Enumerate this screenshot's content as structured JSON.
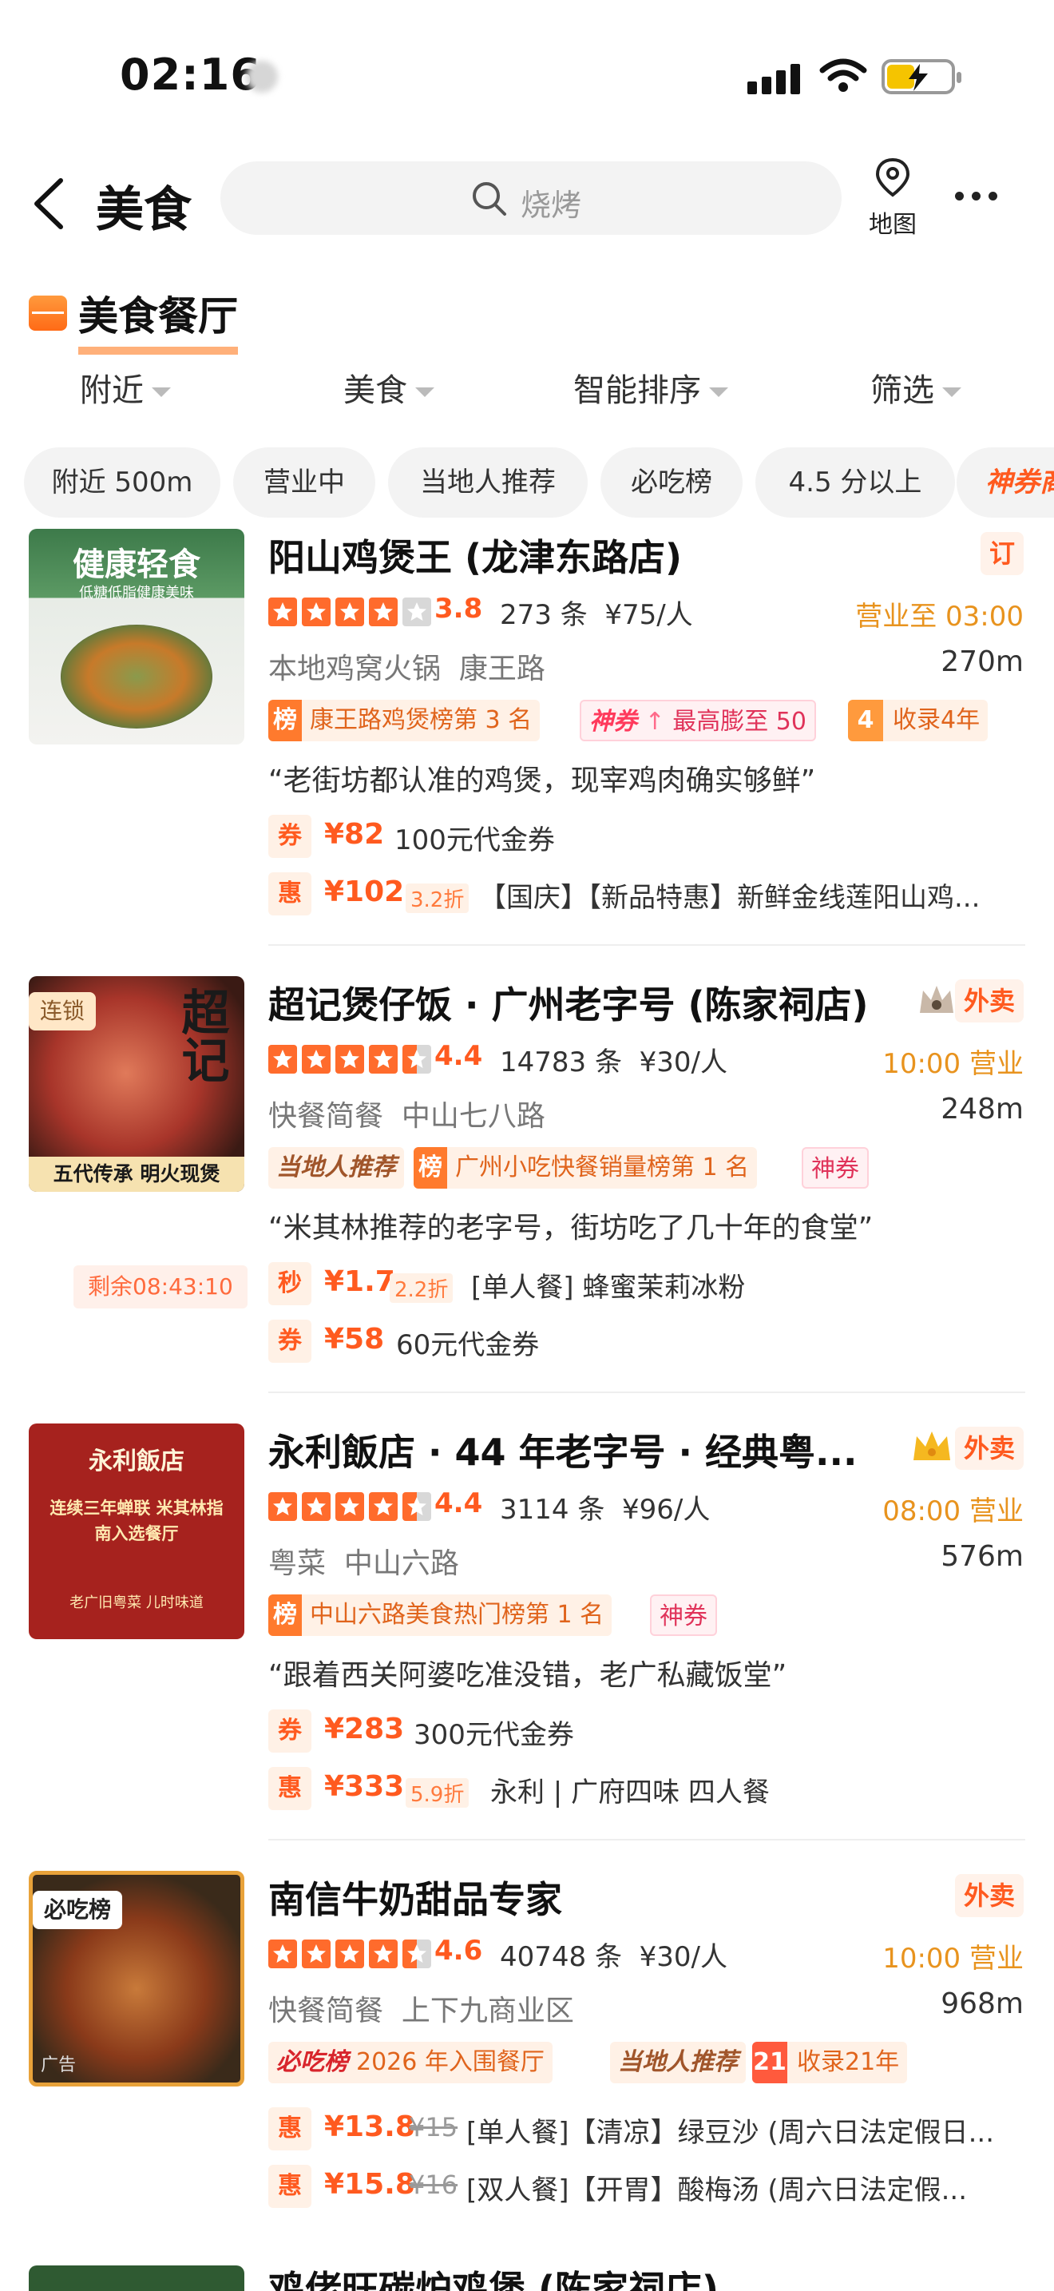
{
  "status_bar": {
    "time": "02:16"
  },
  "nav": {
    "title": "美食",
    "search_placeholder": "烧烤",
    "map_label": "地图"
  },
  "category": {
    "title": "美食餐厅"
  },
  "dropdowns": [
    "附近",
    "美食",
    "智能排序",
    "筛选"
  ],
  "chips": [
    "附近 500m",
    "营业中",
    "当地人推荐",
    "必吃榜",
    "4.5 分以上",
    "神券商"
  ],
  "colors": {
    "accent": "#ff5a1f",
    "star": "#ff6b2c",
    "status": "#e8931e"
  },
  "restaurants": [
    {
      "name": "阳山鸡煲王 (龙津东路店)",
      "badge": "订",
      "thumb_title": "健康轻食",
      "thumb_sub": "低糖低脂健康美味",
      "rating": 3.8,
      "rating_text": "3.8",
      "reviews": "273 条",
      "price": "¥75/人",
      "status": "营业至 03:00",
      "cuisine": "本地鸡窝火锅",
      "area": "康王路",
      "distance": "270m",
      "tag_bang_prefix": "榜",
      "tag_bang": "康王路鸡煲榜第 3 名",
      "tag_shen_prefix": "神券",
      "tag_shen": "最高膨至 50",
      "tag_year_num": "4",
      "tag_year": "收录4年",
      "quote": "“老街坊都认准的鸡煲，现宰鸡肉确实够鲜”",
      "deals": [
        {
          "kind": "券",
          "price": "¥82",
          "desc": "100元代金券"
        },
        {
          "kind": "惠",
          "price": "¥102",
          "discount": "3.2折",
          "desc": "【国庆】【新品特惠】新鲜金线莲阳山鸡..."
        }
      ]
    },
    {
      "name": "超记煲仔饭 · 广州老字号 (陈家祠店)",
      "badge": "外卖",
      "corner_tag": "连锁",
      "thumb_title": "超记",
      "thumb_sub": "五代传承 明火现煲",
      "rating": 4.4,
      "rating_text": "4.4",
      "reviews": "14783 条",
      "price": "¥30/人",
      "status": "10:00 营业",
      "cuisine": "快餐简餐",
      "area": "中山七八路",
      "distance": "248m",
      "tag_local": "当地人推荐",
      "tag_bang_prefix": "榜",
      "tag_bang": "广州小吃快餐销量榜第 1 名",
      "tag_shen_only": "神券",
      "quote": "“米其林推荐的老字号，街坊吃了几十年的食堂”",
      "countdown": "剩余08:43:10",
      "deals": [
        {
          "kind": "秒",
          "price": "¥1.7",
          "discount": "2.2折",
          "desc": "[单人餐] 蜂蜜茉莉冰粉"
        },
        {
          "kind": "券",
          "price": "¥58",
          "desc": "60元代金券"
        }
      ]
    },
    {
      "name": "永利飯店 · 44 年老字号 · 经典粤...",
      "badge": "外卖",
      "thumb_title": "永利飯店",
      "thumb_sub": "连续三年蝉联 米其林指南入选餐厅",
      "thumb_foot": "老广旧粤菜 儿时味道",
      "rating": 4.4,
      "rating_text": "4.4",
      "reviews": "3114 条",
      "price": "¥96/人",
      "status": "08:00 营业",
      "cuisine": "粤菜",
      "area": "中山六路",
      "distance": "576m",
      "tag_bang_prefix": "榜",
      "tag_bang": "中山六路美食热门榜第 1 名",
      "tag_shen_only": "神券",
      "quote": "“跟着西关阿婆吃准没错，老广私藏饭堂”",
      "deals": [
        {
          "kind": "券",
          "price": "¥283",
          "desc": "300元代金券"
        },
        {
          "kind": "惠",
          "price": "¥333",
          "discount": "5.9折",
          "desc": "永利 | 广府四味 四人餐"
        }
      ]
    },
    {
      "name": "南信牛奶甜品专家",
      "badge": "外卖",
      "corner_tag": "必吃榜",
      "ad_label": "广告",
      "rating": 4.6,
      "rating_text": "4.6",
      "reviews": "40748 条",
      "price": "¥30/人",
      "status": "10:00 营业",
      "cuisine": "快餐简餐",
      "area": "上下九商业区",
      "distance": "968m",
      "tag_bichi_prefix": "必吃榜",
      "tag_bichi": "2026 年入围餐厅",
      "tag_local": "当地人推荐",
      "tag_year_num": "21",
      "tag_year": "收录21年",
      "deals": [
        {
          "kind": "惠",
          "price": "¥13.8",
          "orig": "¥15",
          "desc": "[单人餐]【清凉】绿豆沙 (周六日法定假日..."
        },
        {
          "kind": "惠",
          "price": "¥15.8",
          "orig": "¥16",
          "desc": "[双人餐]【开胃】酸梅汤 (周六日法定假..."
        }
      ]
    }
  ],
  "next_restaurant": {
    "name": "鸡佬旺碳炉鸡煲 (陈家祠店)"
  }
}
